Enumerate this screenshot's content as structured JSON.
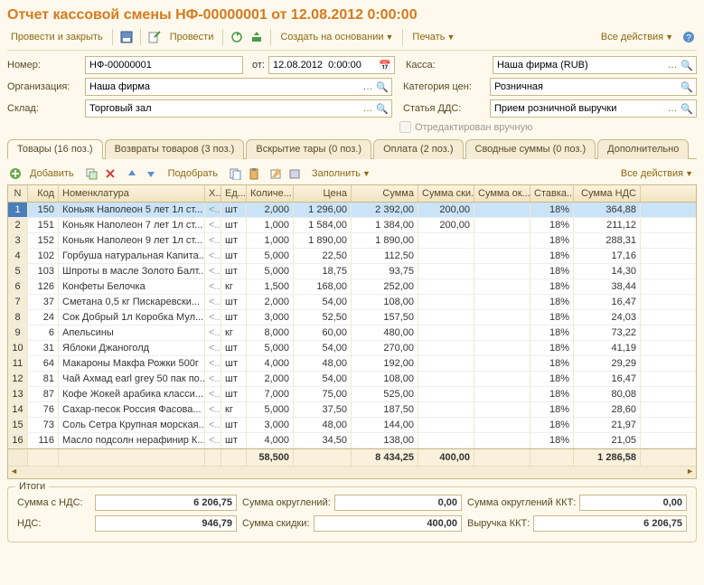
{
  "title": "Отчет кассовой смены НФ-00000001 от 12.08.2012 0:00:00",
  "toolbar": {
    "submit": "Провести и закрыть",
    "post": "Провести",
    "create": "Создать на основании",
    "print": "Печать",
    "all": "Все действия"
  },
  "fields": {
    "number_lbl": "Номер:",
    "number": "НФ-00000001",
    "from_lbl": "от:",
    "date": "12.08.2012  0:00:00",
    "kassa_lbl": "Касса:",
    "kassa": "Наша фирма (RUB)",
    "org_lbl": "Организация:",
    "org": "Наша фирма",
    "cat_lbl": "Категория цен:",
    "cat": "Розничная",
    "sklad_lbl": "Склад:",
    "sklad": "Торговый зал",
    "dds_lbl": "Статья ДДС:",
    "dds": "Прием розничной выручки",
    "manual": "Отредактирован вручную"
  },
  "tabs": [
    {
      "label": "Товары (16 поз.)",
      "active": true
    },
    {
      "label": "Возвраты товаров (3 поз.)"
    },
    {
      "label": "Вскрытие тары (0 поз.)"
    },
    {
      "label": "Оплата (2 поз.)"
    },
    {
      "label": "Сводные суммы (0 поз.)"
    },
    {
      "label": "Дополнительно"
    }
  ],
  "gridtb": {
    "add": "Добавить",
    "select": "Подобрать",
    "fill": "Заполнить",
    "all": "Все действия"
  },
  "head": {
    "n": "N",
    "kod": "Код",
    "nom": "Номенклатура",
    "h": "Х...",
    "ed": "Ед...",
    "qty": "Количе...",
    "price": "Цена",
    "sum": "Сумма",
    "disc": "Сумма ски...",
    "ok": "Сумма ок...",
    "rate": "Ставка...",
    "nds": "Сумма НДС"
  },
  "rows": [
    {
      "n": 1,
      "kod": "150",
      "nom": "Коньяк Наполеон 5 лет 1л ст...",
      "ed": "шт",
      "qty": "2,000",
      "pr": "1 296,00",
      "sum": "2 392,00",
      "sk": "200,00",
      "ok": "",
      "st": "18%",
      "nds": "364,88"
    },
    {
      "n": 2,
      "kod": "151",
      "nom": "Коньяк Наполеон 7 лет 1л ст...",
      "ed": "шт",
      "qty": "1,000",
      "pr": "1 584,00",
      "sum": "1 384,00",
      "sk": "200,00",
      "ok": "",
      "st": "18%",
      "nds": "211,12"
    },
    {
      "n": 3,
      "kod": "152",
      "nom": "Коньяк Наполеон 9 лет 1л ст...",
      "ed": "шт",
      "qty": "1,000",
      "pr": "1 890,00",
      "sum": "1 890,00",
      "sk": "",
      "ok": "",
      "st": "18%",
      "nds": "288,31"
    },
    {
      "n": 4,
      "kod": "102",
      "nom": "Горбуша натуральная Капита...",
      "ed": "шт",
      "qty": "5,000",
      "pr": "22,50",
      "sum": "112,50",
      "sk": "",
      "ok": "",
      "st": "18%",
      "nds": "17,16"
    },
    {
      "n": 5,
      "kod": "103",
      "nom": "Шпроты в масле Золото Балт...",
      "ed": "шт",
      "qty": "5,000",
      "pr": "18,75",
      "sum": "93,75",
      "sk": "",
      "ok": "",
      "st": "18%",
      "nds": "14,30"
    },
    {
      "n": 6,
      "kod": "126",
      "nom": "Конфеты Белочка",
      "ed": "кг",
      "qty": "1,500",
      "pr": "168,00",
      "sum": "252,00",
      "sk": "",
      "ok": "",
      "st": "18%",
      "nds": "38,44"
    },
    {
      "n": 7,
      "kod": "37",
      "nom": "Сметана 0,5 кг  Пискаревски...",
      "ed": "шт",
      "qty": "2,000",
      "pr": "54,00",
      "sum": "108,00",
      "sk": "",
      "ok": "",
      "st": "18%",
      "nds": "16,47"
    },
    {
      "n": 8,
      "kod": "24",
      "nom": "Сок Добрый 1л Коробка Мул...",
      "ed": "шт",
      "qty": "3,000",
      "pr": "52,50",
      "sum": "157,50",
      "sk": "",
      "ok": "",
      "st": "18%",
      "nds": "24,03"
    },
    {
      "n": 9,
      "kod": "6",
      "nom": "Апельсины",
      "ed": "кг",
      "qty": "8,000",
      "pr": "60,00",
      "sum": "480,00",
      "sk": "",
      "ok": "",
      "st": "18%",
      "nds": "73,22"
    },
    {
      "n": 10,
      "kod": "31",
      "nom": "Яблоки Джаноголд",
      "ed": "шт",
      "qty": "5,000",
      "pr": "54,00",
      "sum": "270,00",
      "sk": "",
      "ok": "",
      "st": "18%",
      "nds": "41,19"
    },
    {
      "n": 11,
      "kod": "64",
      "nom": "Макароны Макфа Рожки 500г",
      "ed": "шт",
      "qty": "4,000",
      "pr": "48,00",
      "sum": "192,00",
      "sk": "",
      "ok": "",
      "st": "18%",
      "nds": "29,29"
    },
    {
      "n": 12,
      "kod": "81",
      "nom": "Чай Ахмад earl grey 50 пак по...",
      "ed": "шт",
      "qty": "2,000",
      "pr": "54,00",
      "sum": "108,00",
      "sk": "",
      "ok": "",
      "st": "18%",
      "nds": "16,47"
    },
    {
      "n": 13,
      "kod": "87",
      "nom": "Кофе Жокей арабика класси...",
      "ed": "шт",
      "qty": "7,000",
      "pr": "75,00",
      "sum": "525,00",
      "sk": "",
      "ok": "",
      "st": "18%",
      "nds": "80,08"
    },
    {
      "n": 14,
      "kod": "76",
      "nom": "Сахар-песок Россия Фасова...",
      "ed": "кг",
      "qty": "5,000",
      "pr": "37,50",
      "sum": "187,50",
      "sk": "",
      "ok": "",
      "st": "18%",
      "nds": "28,60"
    },
    {
      "n": 15,
      "kod": "73",
      "nom": "Соль Сетра Крупная морская...",
      "ed": "шт",
      "qty": "3,000",
      "pr": "48,00",
      "sum": "144,00",
      "sk": "",
      "ok": "",
      "st": "18%",
      "nds": "21,97"
    },
    {
      "n": 16,
      "kod": "116",
      "nom": "Масло подсолн нерафинир К...",
      "ed": "шт",
      "qty": "4,000",
      "pr": "34,50",
      "sum": "138,00",
      "sk": "",
      "ok": "",
      "st": "18%",
      "nds": "21,05"
    }
  ],
  "foot": {
    "qty": "58,500",
    "sum": "8 434,25",
    "sk": "400,00",
    "nds": "1 286,58"
  },
  "totals": {
    "legend": "Итоги",
    "sum_nds_l": "Сумма с НДС:",
    "sum_nds": "6 206,75",
    "round_l": "Сумма округлений:",
    "round": "0,00",
    "kkt_round_l": "Сумма округлений ККТ:",
    "kkt_round": "0,00",
    "nds_l": "НДС:",
    "nds": "946,79",
    "disc_l": "Сумма скидки:",
    "disc": "400,00",
    "kkt_l": "Выручка ККТ:",
    "kkt": "6 206,75"
  }
}
